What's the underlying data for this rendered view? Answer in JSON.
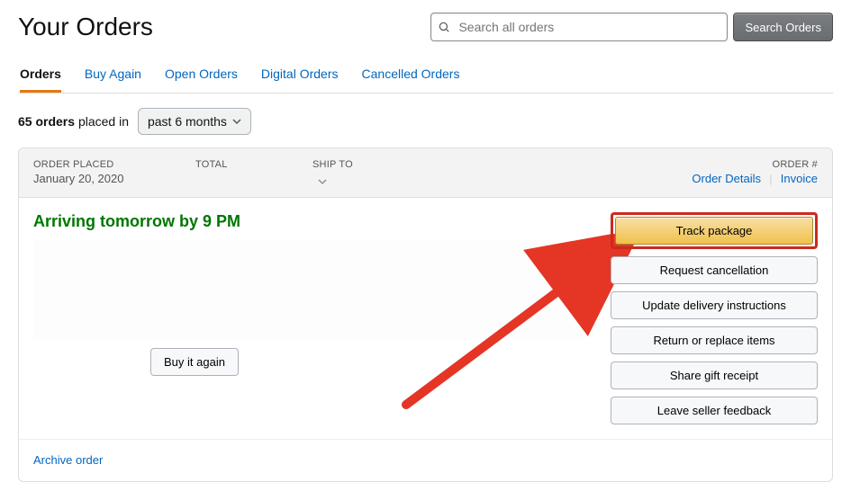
{
  "header": {
    "title": "Your Orders",
    "search_placeholder": "Search all orders",
    "search_button": "Search Orders"
  },
  "tabs": [
    {
      "label": "Orders",
      "active": true
    },
    {
      "label": "Buy Again",
      "active": false
    },
    {
      "label": "Open Orders",
      "active": false
    },
    {
      "label": "Digital Orders",
      "active": false
    },
    {
      "label": "Cancelled Orders",
      "active": false
    }
  ],
  "filter": {
    "count": "65 orders",
    "placed_in_text": "placed in",
    "period": "past 6 months"
  },
  "order": {
    "placed_label": "ORDER PLACED",
    "placed_value": "January 20, 2020",
    "total_label": "TOTAL",
    "total_value": "",
    "ship_to_label": "SHIP TO",
    "ship_to_value": "",
    "order_num_label": "ORDER #",
    "order_num_value": "",
    "details_link": "Order Details",
    "invoice_link": "Invoice",
    "status": "Arriving tomorrow by 9 PM",
    "buy_again": "Buy it again",
    "actions": {
      "track": "Track package",
      "cancel": "Request cancellation",
      "update": "Update delivery instructions",
      "return": "Return or replace items",
      "gift": "Share gift receipt",
      "feedback": "Leave seller feedback"
    },
    "archive": "Archive order"
  }
}
